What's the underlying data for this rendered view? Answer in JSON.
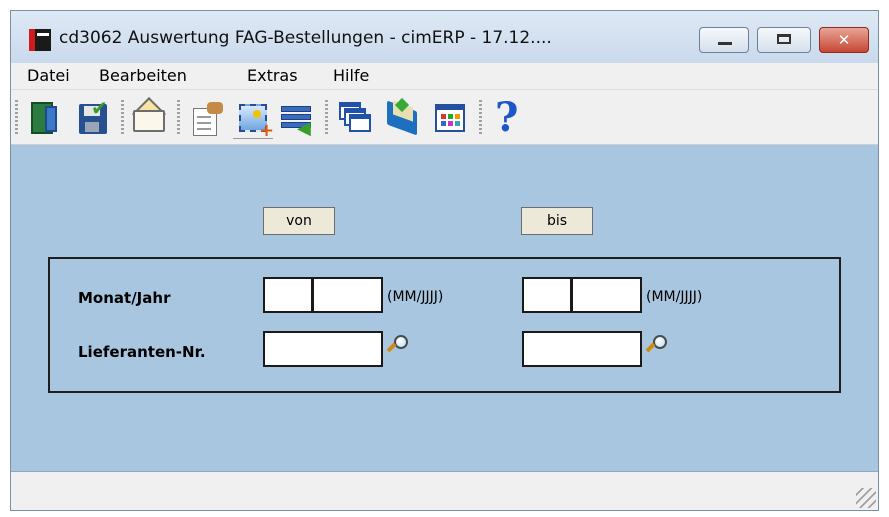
{
  "window": {
    "title": "cd3062 Auswertung FAG-Bestellungen - cimERP - 17.12....",
    "minimize_icon": "minimize-icon",
    "maximize_icon": "maximize-icon",
    "close_label": "✕"
  },
  "menu": {
    "items": [
      "Datei",
      "Bearbeiten",
      "Extras",
      "Hilfe"
    ]
  },
  "toolbar": {
    "icons": [
      "exit-door-icon",
      "save-icon",
      "mail-icon",
      "document-edit-icon",
      "new-record-icon",
      "list-transfer-icon",
      "windows-icon",
      "book-icon",
      "grid-icon",
      "help-icon"
    ]
  },
  "form": {
    "von_label": "von",
    "bis_label": "bis",
    "rows": [
      {
        "label": "Monat/Jahr",
        "hint_from": "(MM/JJJJ)",
        "hint_to": "(MM/JJJJ)"
      },
      {
        "label": "Lieferanten-Nr."
      }
    ],
    "fields": {
      "monat_jahr_von": "",
      "monat_jahr_bis": "",
      "lieferant_von": "",
      "lieferant_bis": ""
    }
  },
  "status": {
    "text": ""
  },
  "colors": {
    "form_background": "#a8c6e0",
    "close_button": "#c74634"
  }
}
